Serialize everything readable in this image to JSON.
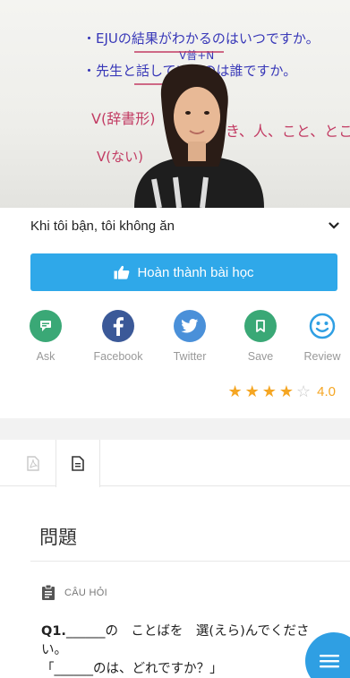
{
  "video": {
    "board_lines": [
      "・EJUの結果がわかるのはいつですか。",
      "V普+N",
      "・先生と話しているのは誰ですか。",
      "V(辞書形)",
      "とき、人、こと、ところ、の",
      "V(ない)"
    ]
  },
  "lesson": {
    "selected": "Khi tôi bận, tôi không ăn"
  },
  "complete_button": {
    "label": "Hoàn thành bài học"
  },
  "share": [
    {
      "label": "Ask",
      "icon": "chat-icon",
      "color": "#3aa876"
    },
    {
      "label": "Facebook",
      "icon": "facebook-icon",
      "color": "#3b5998"
    },
    {
      "label": "Twitter",
      "icon": "twitter-icon",
      "color": "#4a90d9"
    },
    {
      "label": "Save",
      "icon": "bookmark-icon",
      "color": "#3aa876"
    },
    {
      "label": "Review",
      "icon": "smiley-icon",
      "color": "#2f9fe3"
    }
  ],
  "rating": {
    "value": "4.0",
    "filled_stars": 4,
    "total_stars": 5
  },
  "content": {
    "section_title": "問題",
    "question_label": "CÂU HỎI",
    "question_number": "Q1.",
    "question_text": "______の　ことばを　選(えら)んでください。",
    "question_next_line": "「______のは、どれですか？」"
  }
}
